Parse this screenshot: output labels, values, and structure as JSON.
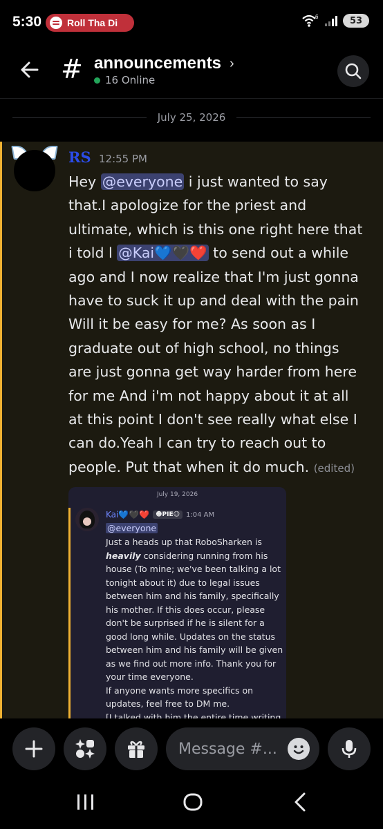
{
  "status_bar": {
    "time": "5:30",
    "now_playing": "Roll Tha Di",
    "network": "6",
    "battery": "53"
  },
  "header": {
    "channel_name": "announcements",
    "online": "16 Online"
  },
  "date_divider": "July 25, 2026",
  "message": {
    "author": "RS",
    "time": "12:55 PM",
    "lines": {
      "l1_pre": "Hey ",
      "l1_mention": "@everyone",
      "l1_post": " i just wanted to say",
      "l2": "that.I apologize for the priest and",
      "l3": "ultimate, which is this one right here that",
      "l4_pre": "i told l ",
      "l4_mention": "@Kai💙🖤❤️",
      "l4_post": " to send out a while",
      "l5": "ago and I now realize that I'm just gonna",
      "l6": "have to suck it up and deal with the pain",
      "l7": "Will it be easy for me? As soon as I",
      "l8": "graduate out of high school, no things",
      "l9": "are just gonna get way harder from here",
      "l10": "for me And i'm not happy about it at all",
      "l11": "at this point I don't see really what else I",
      "l12": "can do.Yeah I can try to reach out to",
      "l13": "people. Put that when it do much. "
    },
    "edited": "(edited)"
  },
  "embed": {
    "date": "July 19, 2026",
    "author": "Kai💙🖤❤️",
    "badge": "☻PIE☺",
    "time": "1:04 AM",
    "mention": "@everyone",
    "lines": {
      "l1": "Just a heads up that RoboSharken is",
      "l2_bold": "heavily",
      "l2_post": " considering running from his",
      "l3": "house (To mine;  we've been talking a lot",
      "l4": "tonight about it) due to legal issues",
      "l5": "between him and his family, specifically",
      "l6": "his mother.  If this does occur, please",
      "l7": "don't be surprised if he is silent for a",
      "l8": "good long while. Updates on the status",
      "l9": "between him and his family will be given",
      "l10": "as we find out more info. Thank you for",
      "l11": "your time everyone.",
      "l12": "If anyone wants more specifics on",
      "l13": "updates, feel free to DM me.",
      "l14": "[I talked with him the entire time writing"
    }
  },
  "input": {
    "placeholder": "Message #..."
  },
  "icons": {
    "back": "arrow-left-icon",
    "search": "search-icon",
    "add": "plus-icon",
    "apps": "apps-icon",
    "gift": "gift-icon",
    "emoji": "emoji-icon",
    "mic": "microphone-icon"
  },
  "colors": {
    "accent_highlight": "#f0b232",
    "mention_bg": "#3c4270",
    "online_green": "#23a55a",
    "author_rs": "#2b4ce8"
  }
}
